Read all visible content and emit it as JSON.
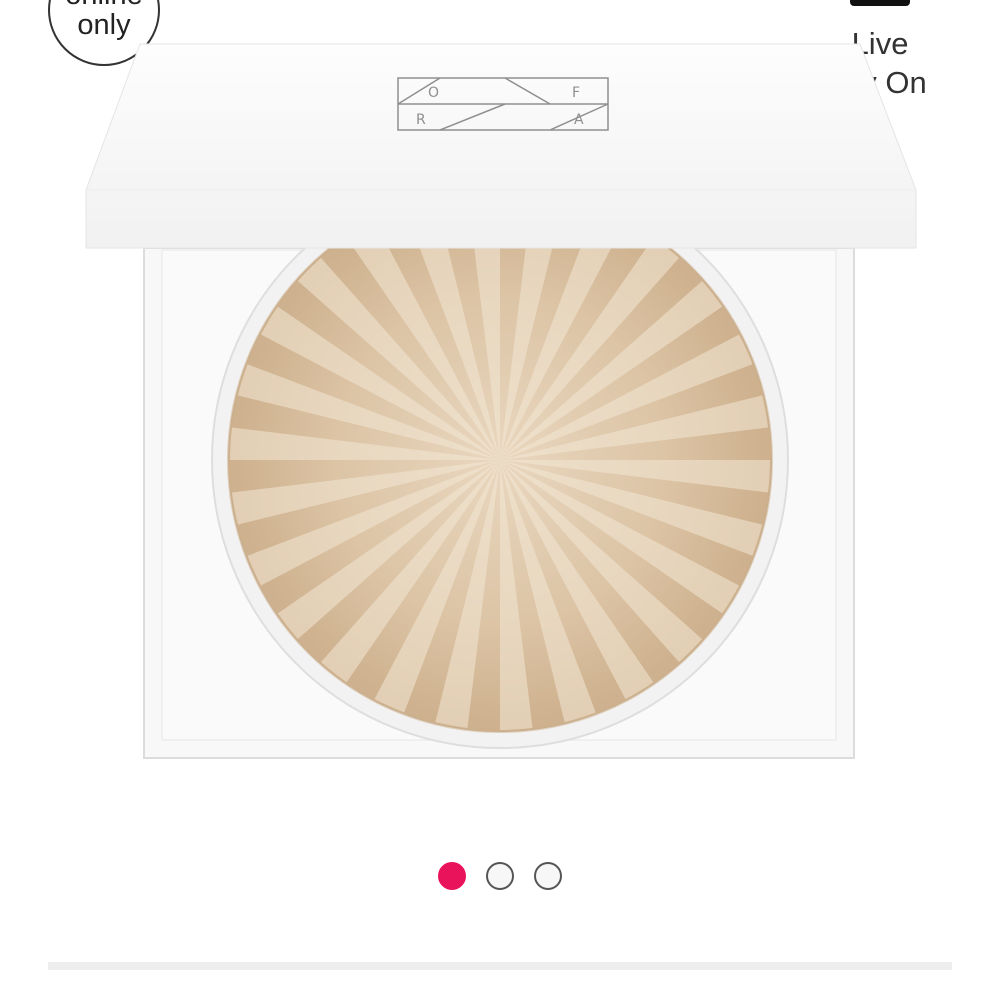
{
  "badge": {
    "line1": "online",
    "line2": "only"
  },
  "live_try_on": {
    "line1": "Live",
    "line2": "Try On"
  },
  "product_image": {
    "logo_letters": [
      "O",
      "F",
      "R",
      "A"
    ]
  },
  "carousel": {
    "total": 3,
    "active_index": 0,
    "accent_color": "#e8135a"
  }
}
